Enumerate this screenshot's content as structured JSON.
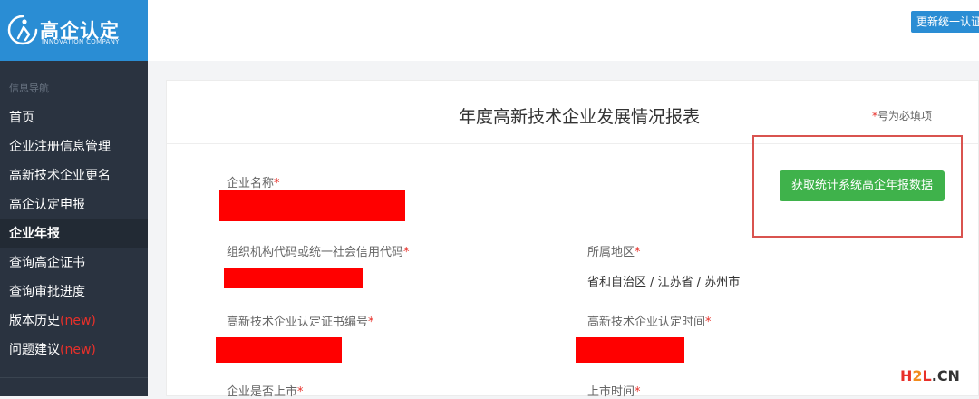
{
  "logo": {
    "title": "高企认定",
    "subtitle": "INNOVATION COMPANY"
  },
  "sidebar": {
    "heading": "信息导航",
    "items": [
      {
        "label": "首页"
      },
      {
        "label": "企业注册信息管理"
      },
      {
        "label": "高新技术企业更名"
      },
      {
        "label": "高企认定申报"
      },
      {
        "label": "企业年报"
      },
      {
        "label": "查询高企证书"
      },
      {
        "label": "查询审批进度"
      },
      {
        "label": "版本历史",
        "badge": "(new)"
      },
      {
        "label": "问题建议",
        "badge": "(new)"
      }
    ],
    "active_index": 4
  },
  "topbar": {
    "button_label": "更新统一认证"
  },
  "form": {
    "title": "年度高新技术企业发展情况报表",
    "required_note_star": "*",
    "required_note": "号为必填项",
    "fetch_button": "获取统计系统高企年报数据",
    "fields": {
      "company_name": "企业名称",
      "org_code": "组织机构代码或统一社会信用代码",
      "region": "所属地区",
      "region_value": "省和自治区 / 江苏省 / 苏州市",
      "cert_no": "高新技术企业认定证书编号",
      "cert_time": "高新技术企业认定时间",
      "listed": "企业是否上市",
      "listed_time": "上市时间"
    },
    "star": "*"
  },
  "watermark": {
    "h": "H",
    "two": "2",
    "l": "L",
    "cn": ".CN"
  },
  "colors": {
    "sidebar_bg": "#2a3340",
    "brand_blue": "#2a8dd4",
    "required_red": "#e8302a",
    "button_green": "#3fb24b",
    "highlight_border": "#d9534f"
  }
}
